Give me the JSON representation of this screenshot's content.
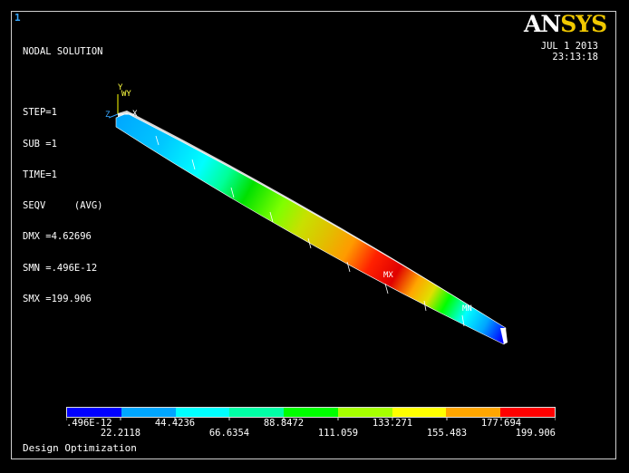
{
  "window": {
    "number": "1"
  },
  "header": {
    "title": "NODAL SOLUTION",
    "step": "STEP=1",
    "sub": "SUB =1",
    "time": "TIME=1",
    "seqv": "SEQV     (AVG)",
    "dmx": "DMX =4.62696",
    "smn": "SMN =.496E-12",
    "smx": "SMX =199.906"
  },
  "logo": {
    "an": "AN",
    "sys": "SYS"
  },
  "datetime": {
    "date": "JUL  1 2013",
    "time": "23:13:18"
  },
  "axes": {
    "y": "Y",
    "wy": "WY",
    "x": "X",
    "z": "Z"
  },
  "markers": {
    "mx": "MX",
    "mn": "MN"
  },
  "legend": {
    "colors": [
      "#0000ff",
      "#00a6ff",
      "#00ffff",
      "#00ffa6",
      "#00ff00",
      "#a6ff00",
      "#ffff00",
      "#ffa600",
      "#ff0000"
    ],
    "labels_top": [
      ".496E-12",
      "44.4236",
      "88.8472",
      "133.271",
      "177.694"
    ],
    "labels_bottom": [
      "22.2118",
      "66.6354",
      "111.059",
      "155.483",
      "199.906"
    ]
  },
  "footer": {
    "text": "Design Optimization"
  }
}
